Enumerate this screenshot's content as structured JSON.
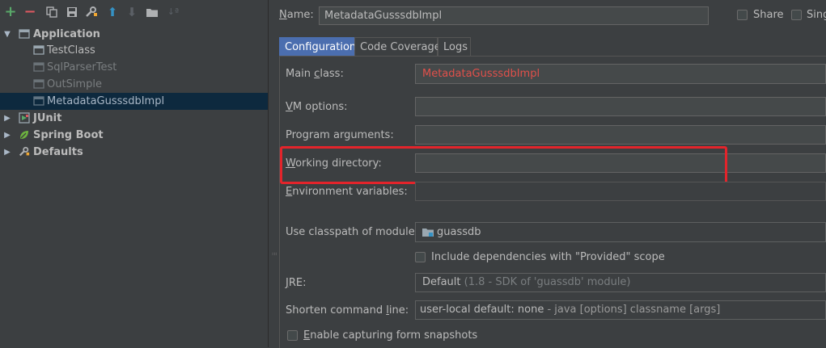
{
  "toolbar": {
    "icons": [
      "add-icon",
      "remove-icon",
      "copy-icon",
      "save-icon",
      "wrench-icon",
      "move-up-icon",
      "move-down-icon",
      "folder-icon",
      "sort-icon"
    ]
  },
  "tree": {
    "application": {
      "label": "Application"
    },
    "children": [
      {
        "label": "TestClass"
      },
      {
        "label": "SqlParserTest"
      },
      {
        "label": "OutSimple"
      },
      {
        "label": "MetadataGusssdbImpl"
      }
    ],
    "junit": {
      "label": "JUnit"
    },
    "spring_boot": {
      "label": "Spring Boot"
    },
    "defaults": {
      "label": "Defaults"
    }
  },
  "form": {
    "name_label": "Name:",
    "name_value": "MetadataGusssdbImpl",
    "share_label": "Share",
    "single_label": "Sing",
    "tabs": [
      "Configuration",
      "Code Coverage",
      "Logs"
    ],
    "main_class_label": "Main class:",
    "main_class_value": "MetadataGusssdbImpl",
    "vm_options_label": "VM options:",
    "program_args_label": "Program arguments:",
    "working_dir_label": "Working directory:",
    "env_vars_label": "Environment variables:",
    "classpath_label": "Use classpath of module:",
    "classpath_value": "guassdb",
    "include_deps_label": "Include dependencies with \"Provided\" scope",
    "jre_label": "JRE:",
    "jre_value_main": "Default",
    "jre_value_detail": "(1.8 - SDK of 'guassdb' module)",
    "shorten_label": "Shorten command line:",
    "shorten_value_main": "user-local default: none",
    "shorten_value_detail": " - java [options] classname [args]",
    "capture_label": "Enable capturing form snapshots"
  },
  "colors": {
    "background": "#3c3f41",
    "selection": "#0d293e",
    "tab_active": "#4b6eaf",
    "error_text": "#e0504a",
    "highlight_box": "#e3242b"
  }
}
